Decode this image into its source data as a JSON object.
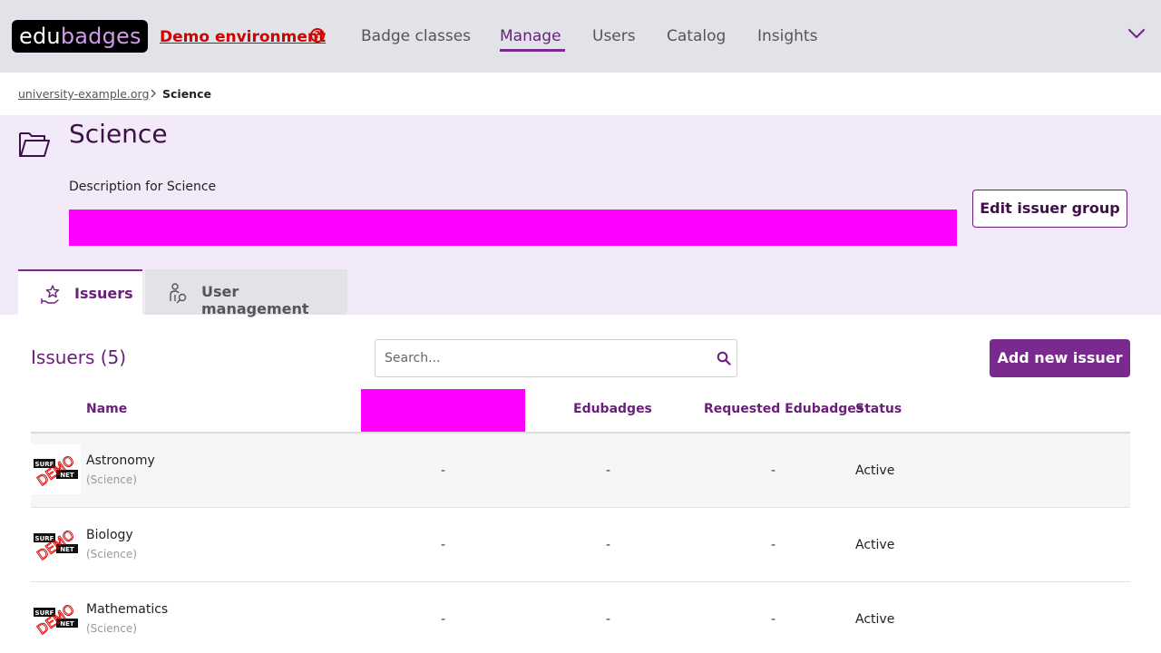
{
  "app": {
    "logo_edu": "edu",
    "logo_badges": "badges",
    "demo_label": "Demo environment",
    "help_glyph": "?"
  },
  "nav": {
    "items": [
      {
        "label": "Badge classes"
      },
      {
        "label": "Manage"
      },
      {
        "label": "Users"
      },
      {
        "label": "Catalog"
      },
      {
        "label": "Insights"
      }
    ],
    "active": "Manage"
  },
  "breadcrumb": {
    "parent": "university-example.org",
    "current": "Science"
  },
  "header": {
    "title": "Science",
    "description": "Description for Science",
    "edit_label": "Edit issuer group"
  },
  "tabs": [
    {
      "label": "Issuers",
      "icon": "star-hand-icon",
      "active": true
    },
    {
      "label": "User management",
      "icon": "user-key-icon",
      "active": false
    }
  ],
  "issuers": {
    "title": "Issuers (5)",
    "search_placeholder": "Search...",
    "add_label": "Add new issuer",
    "columns": {
      "name": "Name",
      "edubadges": "Edubadges",
      "requested": "Requested Edubadges",
      "status": "Status"
    },
    "rows": [
      {
        "name": "Astronomy",
        "group": "(Science)",
        "col2": "-",
        "edubadges": "-",
        "requested": "-",
        "status": "Active"
      },
      {
        "name": "Biology",
        "group": "(Science)",
        "col2": "-",
        "edubadges": "-",
        "requested": "-",
        "status": "Active"
      },
      {
        "name": "Mathematics",
        "group": "(Science)",
        "col2": "-",
        "edubadges": "-",
        "requested": "-",
        "status": "Active"
      }
    ]
  },
  "logo_badge": {
    "top": "SURF",
    "bottom": "NET",
    "stamp": "DEMO"
  },
  "colors": {
    "accent": "#7a2a8e",
    "dark_accent": "#3d1048",
    "header_bg": "#f3eaf9",
    "topbar_bg": "#e1e3e8",
    "demo_red": "#d40000",
    "redaction": "#ff00ff"
  }
}
